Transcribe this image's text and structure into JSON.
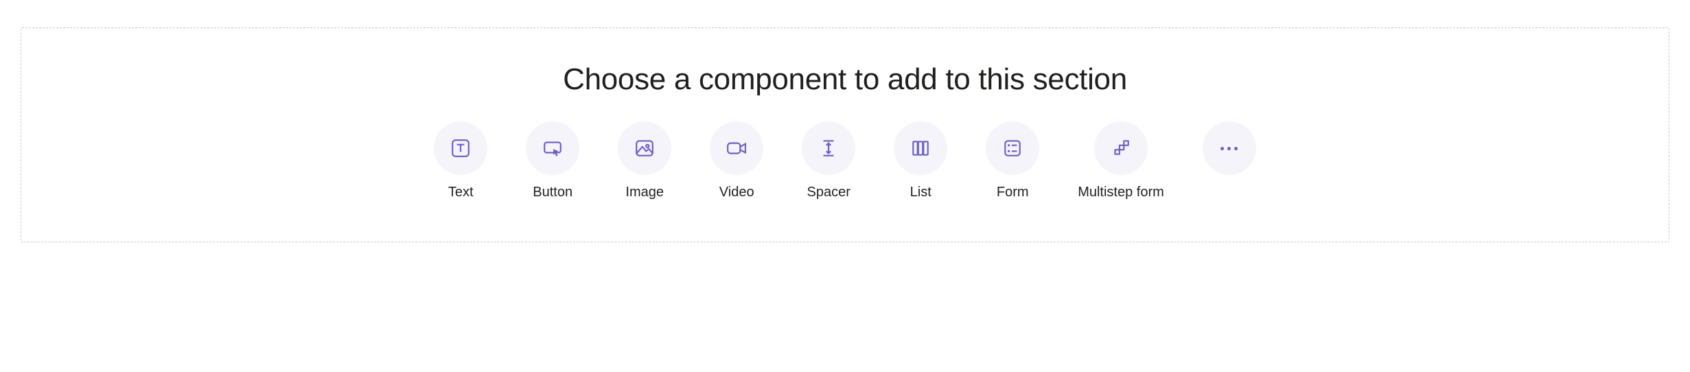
{
  "section": {
    "title": "Choose a component to add to this section"
  },
  "components": {
    "text": {
      "label": "Text",
      "icon": "text-icon"
    },
    "button": {
      "label": "Button",
      "icon": "button-icon"
    },
    "image": {
      "label": "Image",
      "icon": "image-icon"
    },
    "video": {
      "label": "Video",
      "icon": "video-icon"
    },
    "spacer": {
      "label": "Spacer",
      "icon": "spacer-icon"
    },
    "list": {
      "label": "List",
      "icon": "list-icon"
    },
    "form": {
      "label": "Form",
      "icon": "form-icon"
    },
    "multistep": {
      "label": "Multistep form",
      "icon": "multistep-icon"
    }
  },
  "colors": {
    "iconAccent": "#6b5fc6",
    "iconBg": "#f5f4fb",
    "border": "#c8c8c8",
    "text": "#201f1e"
  }
}
